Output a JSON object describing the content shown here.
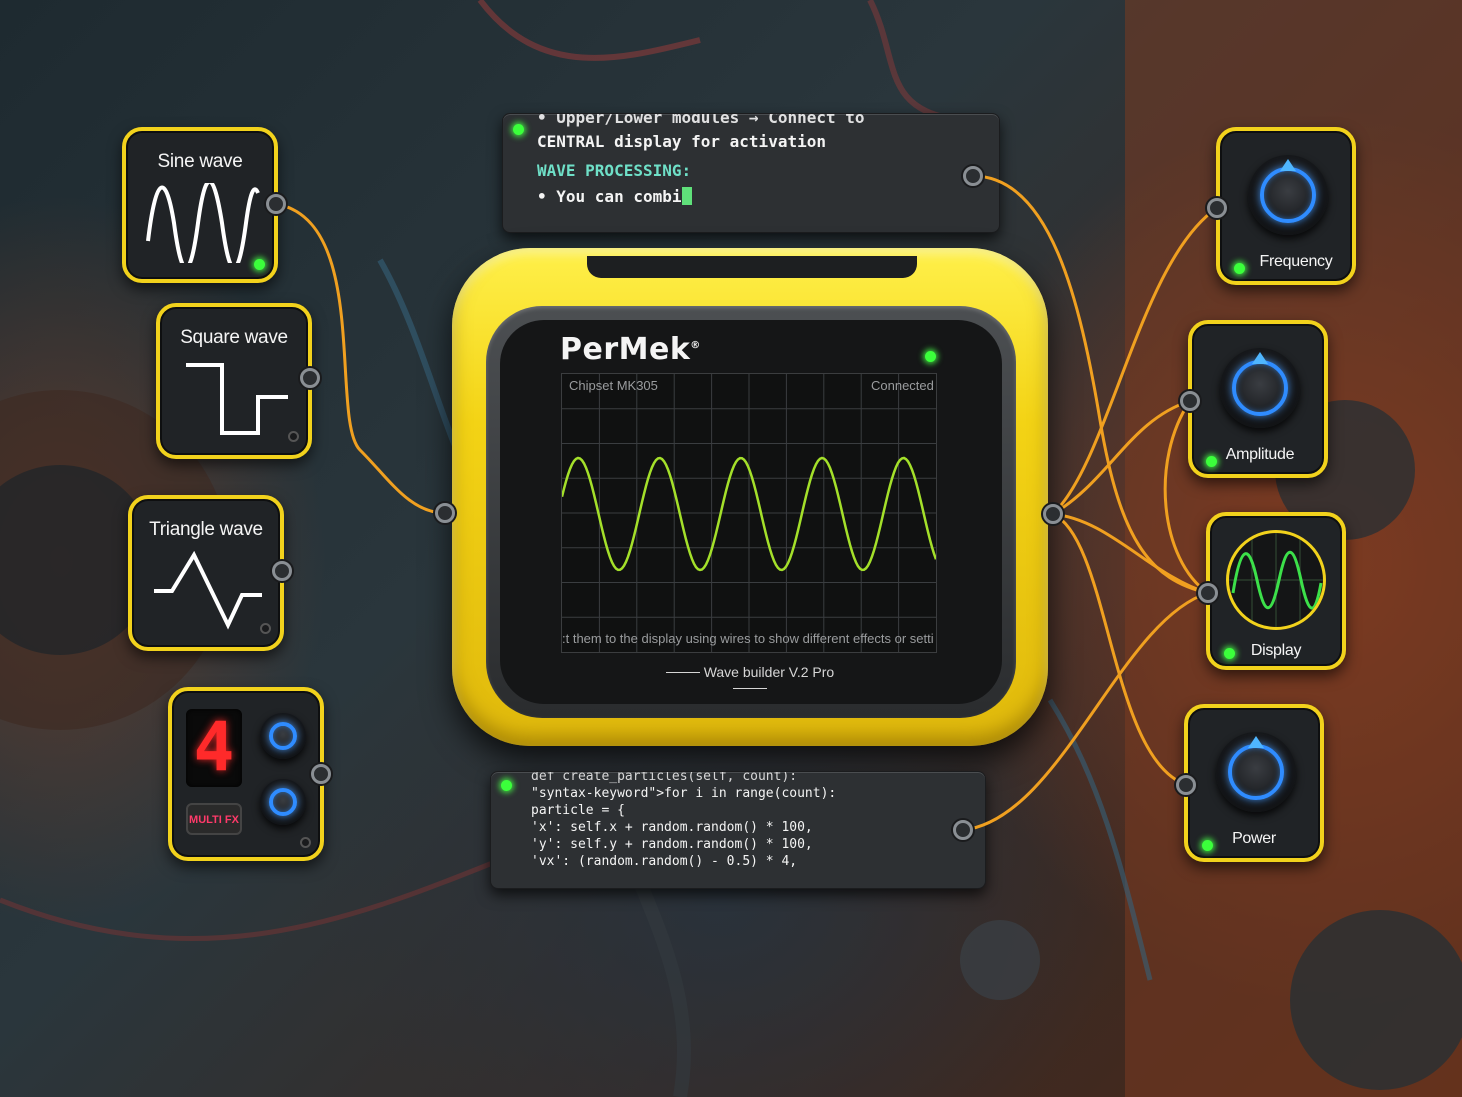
{
  "sine_module": {
    "label": "Sine wave"
  },
  "square_module": {
    "label": "Square wave"
  },
  "triangle_module": {
    "label": "Triangle wave"
  },
  "multifx_module": {
    "digit": "4",
    "label": "MULTI FX"
  },
  "top_terminal": {
    "line0": "• Upper/Lower modules → Connect to",
    "line1": "CENTRAL display for activation",
    "heading": "WAVE PROCESSING:",
    "line3": "• You can combi"
  },
  "code_terminal": {
    "lines": [
      "def create_particles(self, count):",
      "\"syntax-keyword\">for i in range(count):",
      "particle = {",
      "'x': self.x + random.random() * 100,",
      "'y': self.y + random.random() * 100,",
      "'vx': (random.random() - 0.5) * 4,"
    ]
  },
  "device": {
    "brand": "PerMek",
    "brand_mark": "®",
    "chipset": "Chipset MK305",
    "status": "Connected",
    "ticker": ":t them to the display using wires to show different effects or settings. Y",
    "model": "Wave builder V.2 Pro"
  },
  "right_modules": {
    "frequency": "Frequency",
    "amplitude": "Amplitude",
    "display": "Display",
    "power": "Power"
  },
  "colors": {
    "module_border": "#f2d21c",
    "wire": "#f0a020",
    "wave": "#a4e02a",
    "led": "#3bff3b",
    "knob_ring": "#2f8cff"
  }
}
